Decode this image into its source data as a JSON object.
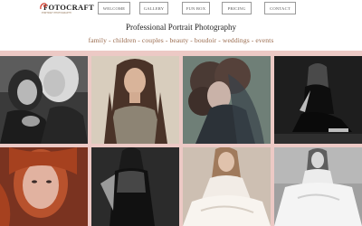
{
  "brand": {
    "name": "FOTOCRAFT",
    "tagline": "PORTRAIT PHOTOGRAPHY"
  },
  "nav": {
    "items": [
      "WELCOME",
      "GALLERY",
      "FUN BOX",
      "PRICING",
      "CONTACT"
    ]
  },
  "page": {
    "title": "Professional Portrait Photography",
    "subtitle": "family - children - couples - beauty - boudoir - weddings - events"
  },
  "colors": {
    "band": "#ecc9c5",
    "subtitle": "#9a6b4e",
    "accent": "#d1301f"
  },
  "gallery": {
    "photos": [
      "mother-daughter-bw-portrait",
      "girl-long-hair-color-portrait",
      "curly-hair-veil-portrait",
      "seated-woman-bw-studio",
      "red-hair-freckles-portrait",
      "woman-sheer-top-bw-portrait",
      "girl-white-dress-portrait",
      "woman-white-gown-bw-portrait"
    ]
  }
}
